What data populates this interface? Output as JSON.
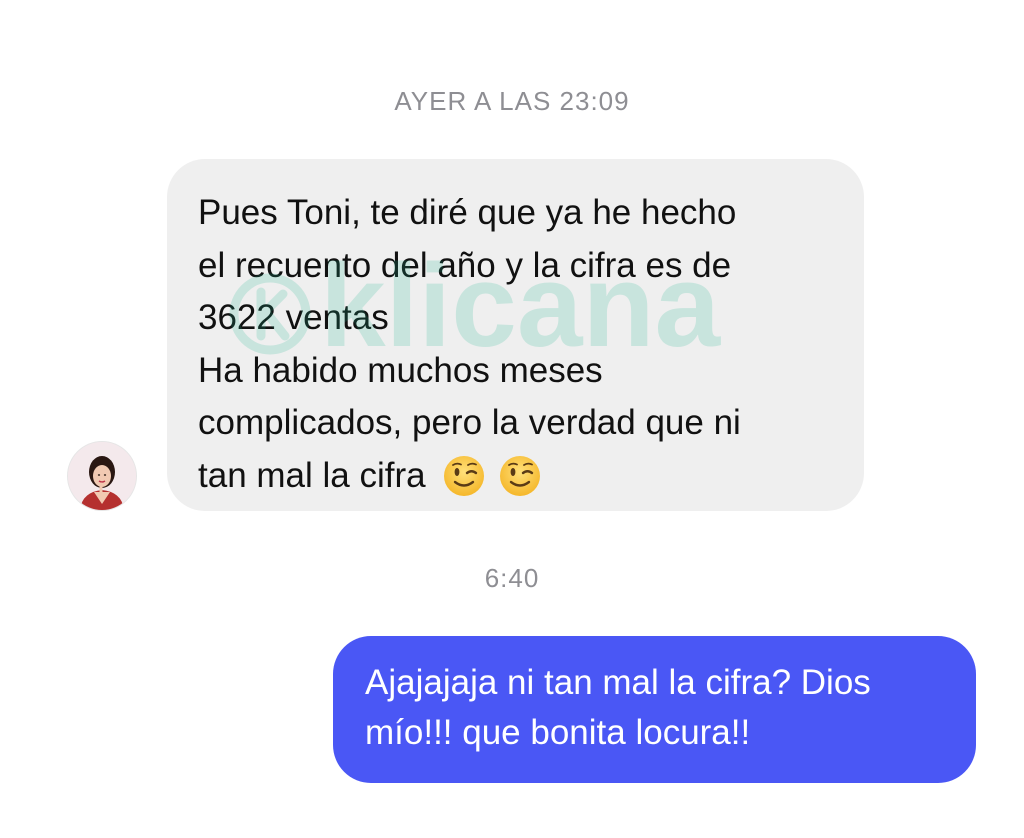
{
  "thread": {
    "timestamp_1": "AYER A LAS 23:09",
    "timestamp_2": "6:40"
  },
  "incoming_message": {
    "lines": [
      "Pues Toni, te diré que ya he hecho",
      "el recuento del año y la cifra es de",
      "3622 ventas",
      "Ha habido muchos meses",
      "complicados, pero la verdad que ni",
      "tan mal la cifra"
    ],
    "emojis": [
      "wink-emoji",
      "wink-emoji"
    ],
    "bubble_color": "#efefef"
  },
  "outgoing_message": {
    "lines": [
      "Ajajajaja ni tan mal la cifra? Dios",
      "mío!!! que bonita locura!!"
    ],
    "bubble_color": "#4a57f5"
  },
  "watermark": {
    "text": "klicana"
  },
  "icons": {
    "avatar": "sender-avatar"
  }
}
